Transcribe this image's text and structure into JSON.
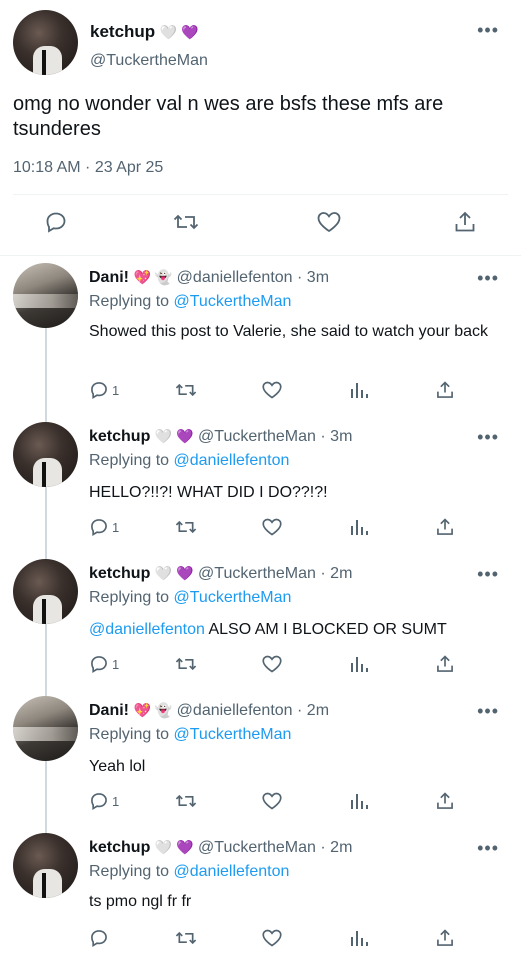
{
  "main_tweet": {
    "author_name": "ketchup",
    "author_emojis": "🤍 💜",
    "handle": "@TuckertheMan",
    "text": "omg no wonder val n wes are bsfs these mfs are tsunderes",
    "timestamp": "10:18 AM · 23 Apr 25",
    "more_label": "•••"
  },
  "replies": [
    {
      "name": "Dani!",
      "emojis": "💖 👻",
      "handle": "@daniellefenton",
      "time": "· 3m",
      "replying_prefix": "Replying to",
      "replying_to": "@TuckertheMan",
      "mention": "",
      "text": "Showed this post to Valerie, she said to watch your back",
      "reply_count": "1",
      "more_label": "•••"
    },
    {
      "name": "ketchup",
      "emojis": "🤍 💜",
      "handle": "@TuckertheMan",
      "time": "· 3m",
      "replying_prefix": "Replying to",
      "replying_to": "@daniellefenton",
      "mention": "",
      "text": "HELLO?!!?! WHAT DID I DO??!?!",
      "reply_count": "1",
      "more_label": "•••"
    },
    {
      "name": "ketchup",
      "emojis": "🤍 💜",
      "handle": "@TuckertheMan",
      "time": "· 2m",
      "replying_prefix": "Replying to",
      "replying_to": "@TuckertheMan",
      "mention": "@daniellefenton",
      "text": " ALSO AM I BLOCKED OR SUMT",
      "reply_count": "1",
      "more_label": "•••"
    },
    {
      "name": "Dani!",
      "emojis": "💖 👻",
      "handle": "@daniellefenton",
      "time": "· 2m",
      "replying_prefix": "Replying to",
      "replying_to": "@TuckertheMan",
      "mention": "",
      "text": "Yeah lol",
      "reply_count": "1",
      "more_label": "•••"
    },
    {
      "name": "ketchup",
      "emojis": "🤍 💜",
      "handle": "@TuckertheMan",
      "time": "· 2m",
      "replying_prefix": "Replying to",
      "replying_to": "@daniellefenton",
      "mention": "",
      "text": "ts pmo ngl fr fr",
      "reply_count": "",
      "more_label": "•••"
    }
  ],
  "colors": {
    "accent": "#1d9bf0",
    "muted": "#536471",
    "text": "#0f1419",
    "divider": "#eff3f4"
  },
  "icons": [
    "reply-icon",
    "retweet-icon",
    "like-icon",
    "share-icon",
    "analytics-icon",
    "more-icon"
  ]
}
